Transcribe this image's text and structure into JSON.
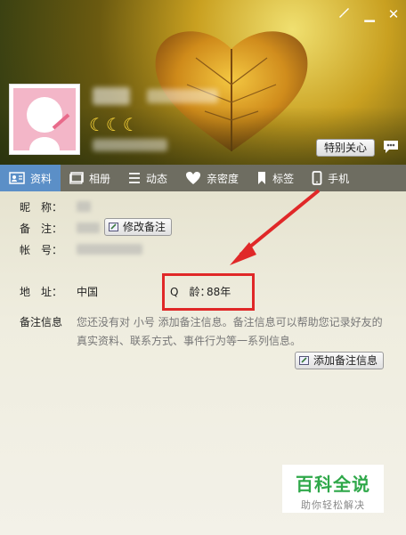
{
  "window": {
    "skin_icon": "paintbrush-icon",
    "minimize_icon": "minimize-icon",
    "close_icon": "close-icon",
    "minimize_glyph": "▁",
    "close_glyph": "✕"
  },
  "profile": {
    "level_moons": "☾☾☾",
    "special_care_label": "特别关心",
    "chat_icon": "chat-bubble-icon"
  },
  "tabs": [
    {
      "label": "资料",
      "icon": "profile-card-icon",
      "active": true
    },
    {
      "label": "相册",
      "icon": "photo-album-icon",
      "active": false
    },
    {
      "label": "动态",
      "icon": "feed-list-icon",
      "active": false
    },
    {
      "label": "亲密度",
      "icon": "heart-icon",
      "active": false
    },
    {
      "label": "标签",
      "icon": "bookmark-icon",
      "active": false
    },
    {
      "label": "手机",
      "icon": "phone-icon",
      "active": false
    }
  ],
  "info": {
    "nickname_label": "昵　称：",
    "remark_label": "备　注：",
    "edit_remark_button": "修改备注",
    "account_label": "帐　号：",
    "address_label": "地　址：",
    "address_value": "中国",
    "qage_label": "Q　龄：",
    "qage_value": "88年",
    "note_label": "备注信息",
    "note_text": "您还没有对 小号 添加备注信息。备注信息可以帮助您记录好友的真实资料、联系方式、事件行为等一系列信息。",
    "add_note_button": "添加备注信息"
  },
  "watermark": {
    "title": "百科全说",
    "subtitle": "助你轻松解决"
  },
  "colors": {
    "tab_active": "#5b8fc7",
    "highlight": "#e02828",
    "watermark_green": "#2fa84a"
  }
}
